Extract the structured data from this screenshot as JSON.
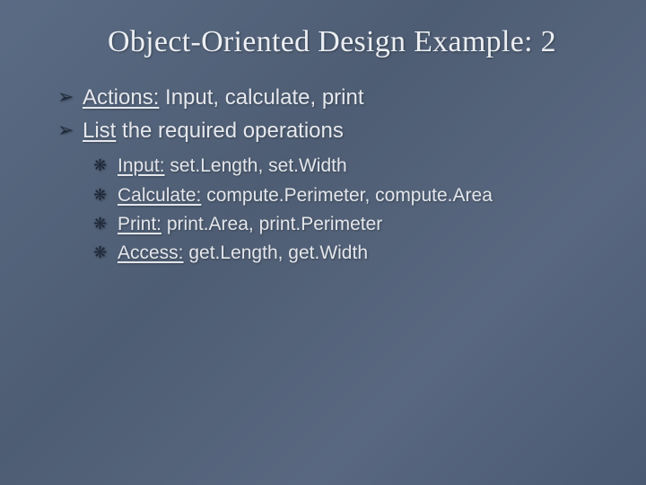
{
  "title": "Object-Oriented Design Example: 2",
  "main": [
    {
      "label": "Actions:",
      "rest": " Input, calculate, print"
    },
    {
      "label": "List",
      "rest": " the required operations"
    }
  ],
  "sub": [
    {
      "label": "Input:",
      "rest": "  set.Length, set.Width"
    },
    {
      "label": "Calculate:",
      "rest": " compute.Perimeter, compute.Area"
    },
    {
      "label": "Print:",
      "rest": " print.Area, print.Perimeter"
    },
    {
      "label": "Access:",
      "rest": " get.Length, get.Width"
    }
  ]
}
